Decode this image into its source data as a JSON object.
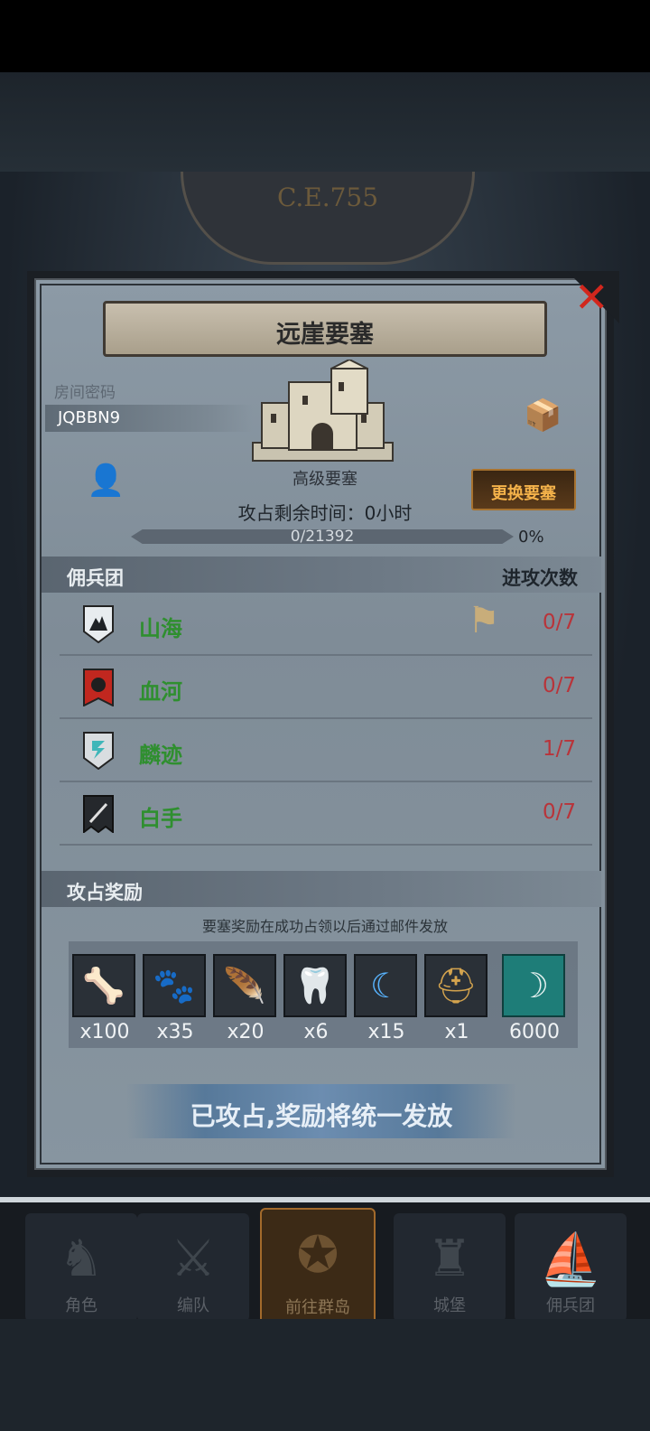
{
  "background": {
    "era_text": "C.E.755"
  },
  "panel": {
    "title": "远崖要塞",
    "room_label": "房间密码",
    "room_code": "JQBBN9",
    "fortress_name": "高级要塞",
    "capture_time_label": "攻占剩余时间：0小时",
    "change_fortress_label": "更换要塞",
    "progress": {
      "text": "0/21392",
      "current": 0,
      "total": 21392,
      "percent_label": "0%"
    }
  },
  "mercenaries": {
    "header": "佣兵团",
    "header_right": "进攻次数",
    "rows": [
      {
        "name": "山海",
        "count": "0/7",
        "color": "#2f8f2f",
        "has_flag": true
      },
      {
        "name": "血河",
        "count": "0/7",
        "color": "#2f8f2f",
        "has_flag": false
      },
      {
        "name": "麟迹",
        "count": "1/7",
        "color": "#2f8f2f",
        "has_flag": false
      },
      {
        "name": "白手",
        "count": "0/7",
        "color": "#2f8f2f",
        "has_flag": false
      }
    ]
  },
  "rewards": {
    "header": "攻占奖励",
    "note": "要塞奖励在成功占领以后通过邮件发放",
    "items": [
      {
        "icon": "fur-pelt-icon",
        "qty": "x100"
      },
      {
        "icon": "claw-icon",
        "qty": "x35"
      },
      {
        "icon": "scale-hide-icon",
        "qty": "x20"
      },
      {
        "icon": "horn-icon",
        "qty": "x6"
      },
      {
        "icon": "blue-crescent-icon",
        "qty": "x15"
      },
      {
        "icon": "helmet-medal-icon",
        "qty": "x1"
      },
      {
        "icon": "banner-icon",
        "qty": "6000"
      }
    ],
    "claim_text": "已攻占,奖励将统一发放"
  },
  "nav": {
    "items": [
      {
        "label": "角色",
        "active": false
      },
      {
        "label": "编队",
        "active": false
      },
      {
        "label": "前往群岛",
        "active": true
      },
      {
        "label": "城堡",
        "active": false
      },
      {
        "label": "佣兵团",
        "active": false
      }
    ]
  },
  "colors": {
    "accent_orange": "#f4b24a",
    "count_red": "#b8343a",
    "name_green": "#2f8f2f"
  }
}
